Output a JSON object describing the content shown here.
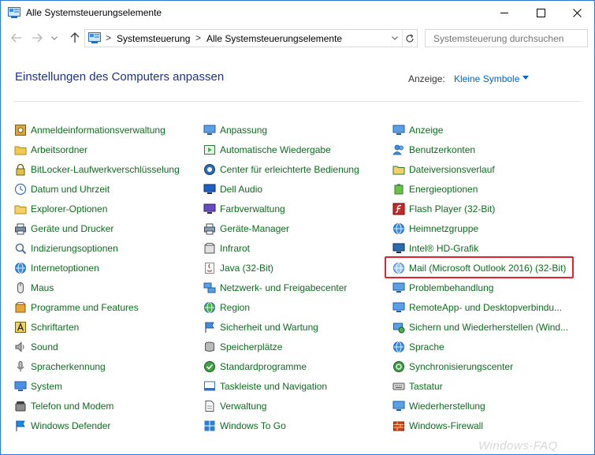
{
  "window": {
    "title": "Alle Systemsteuerungselemente"
  },
  "address": {
    "crumbs": [
      "Systemsteuerung",
      "Alle Systemsteuerungselemente"
    ],
    "separator": ">"
  },
  "search": {
    "placeholder": "Systemsteuerung durchsuchen"
  },
  "header": {
    "title": "Einstellungen des Computers anpassen",
    "view_label": "Anzeige:",
    "view_value": "Kleine Symbole"
  },
  "columns": [
    [
      {
        "label": "Anmeldeinformationsverwaltung",
        "icon": "credential-manager-icon"
      },
      {
        "label": "Arbeitsordner",
        "icon": "work-folders-icon"
      },
      {
        "label": "BitLocker-Laufwerkverschlüsselung",
        "icon": "bitlocker-icon"
      },
      {
        "label": "Datum und Uhrzeit",
        "icon": "date-time-icon"
      },
      {
        "label": "Explorer-Optionen",
        "icon": "explorer-options-icon"
      },
      {
        "label": "Geräte und Drucker",
        "icon": "devices-printers-icon"
      },
      {
        "label": "Indizierungsoptionen",
        "icon": "indexing-icon"
      },
      {
        "label": "Internetoptionen",
        "icon": "internet-options-icon"
      },
      {
        "label": "Maus",
        "icon": "mouse-icon"
      },
      {
        "label": "Programme und Features",
        "icon": "programs-features-icon"
      },
      {
        "label": "Schriftarten",
        "icon": "fonts-icon"
      },
      {
        "label": "Sound",
        "icon": "sound-icon"
      },
      {
        "label": "Spracherkennung",
        "icon": "speech-recognition-icon"
      },
      {
        "label": "System",
        "icon": "system-icon"
      },
      {
        "label": "Telefon und Modem",
        "icon": "phone-modem-icon"
      },
      {
        "label": "Windows Defender",
        "icon": "windows-defender-icon"
      }
    ],
    [
      {
        "label": "Anpassung",
        "icon": "personalization-icon"
      },
      {
        "label": "Automatische Wiedergabe",
        "icon": "autoplay-icon"
      },
      {
        "label": "Center für erleichterte Bedienung",
        "icon": "ease-of-access-icon"
      },
      {
        "label": "Dell Audio",
        "icon": "dell-audio-icon"
      },
      {
        "label": "Farbverwaltung",
        "icon": "color-management-icon"
      },
      {
        "label": "Geräte-Manager",
        "icon": "device-manager-icon"
      },
      {
        "label": "Infrarot",
        "icon": "infrared-icon"
      },
      {
        "label": "Java (32-Bit)",
        "icon": "java-icon"
      },
      {
        "label": "Netzwerk- und Freigabecenter",
        "icon": "network-sharing-icon"
      },
      {
        "label": "Region",
        "icon": "region-icon"
      },
      {
        "label": "Sicherheit und Wartung",
        "icon": "security-maintenance-icon"
      },
      {
        "label": "Speicherplätze",
        "icon": "storage-spaces-icon"
      },
      {
        "label": "Standardprogramme",
        "icon": "default-programs-icon"
      },
      {
        "label": "Taskleiste und Navigation",
        "icon": "taskbar-icon"
      },
      {
        "label": "Verwaltung",
        "icon": "administrative-tools-icon"
      },
      {
        "label": "Windows To Go",
        "icon": "windows-to-go-icon"
      }
    ],
    [
      {
        "label": "Anzeige",
        "icon": "display-icon"
      },
      {
        "label": "Benutzerkonten",
        "icon": "user-accounts-icon"
      },
      {
        "label": "Dateiversionsverlauf",
        "icon": "file-history-icon"
      },
      {
        "label": "Energieoptionen",
        "icon": "power-options-icon"
      },
      {
        "label": "Flash Player (32-Bit)",
        "icon": "flash-player-icon"
      },
      {
        "label": "Heimnetzgruppe",
        "icon": "homegroup-icon"
      },
      {
        "label": "Intel® HD-Grafik",
        "icon": "intel-graphics-icon"
      },
      {
        "label": "Mail (Microsoft Outlook 2016) (32-Bit)",
        "icon": "mail-icon"
      },
      {
        "label": "Problembehandlung",
        "icon": "troubleshooting-icon"
      },
      {
        "label": "RemoteApp- und Desktopverbindu...",
        "icon": "remoteapp-icon"
      },
      {
        "label": "Sichern und Wiederherstellen (Wind...",
        "icon": "backup-restore-icon"
      },
      {
        "label": "Sprache",
        "icon": "language-icon"
      },
      {
        "label": "Synchronisierungscenter",
        "icon": "sync-center-icon"
      },
      {
        "label": "Tastatur",
        "icon": "keyboard-icon"
      },
      {
        "label": "Wiederherstellung",
        "icon": "recovery-icon"
      },
      {
        "label": "Windows-Firewall",
        "icon": "windows-firewall-icon"
      }
    ]
  ],
  "highlighted_item": "Mail (Microsoft Outlook 2016) (32-Bit)",
  "watermark": "Windows-FAQ",
  "colors": {
    "item_text": "#0e6b1e",
    "title_text": "#1e3287",
    "link_blue": "#0066cc",
    "highlight_border": "#e3212f"
  }
}
